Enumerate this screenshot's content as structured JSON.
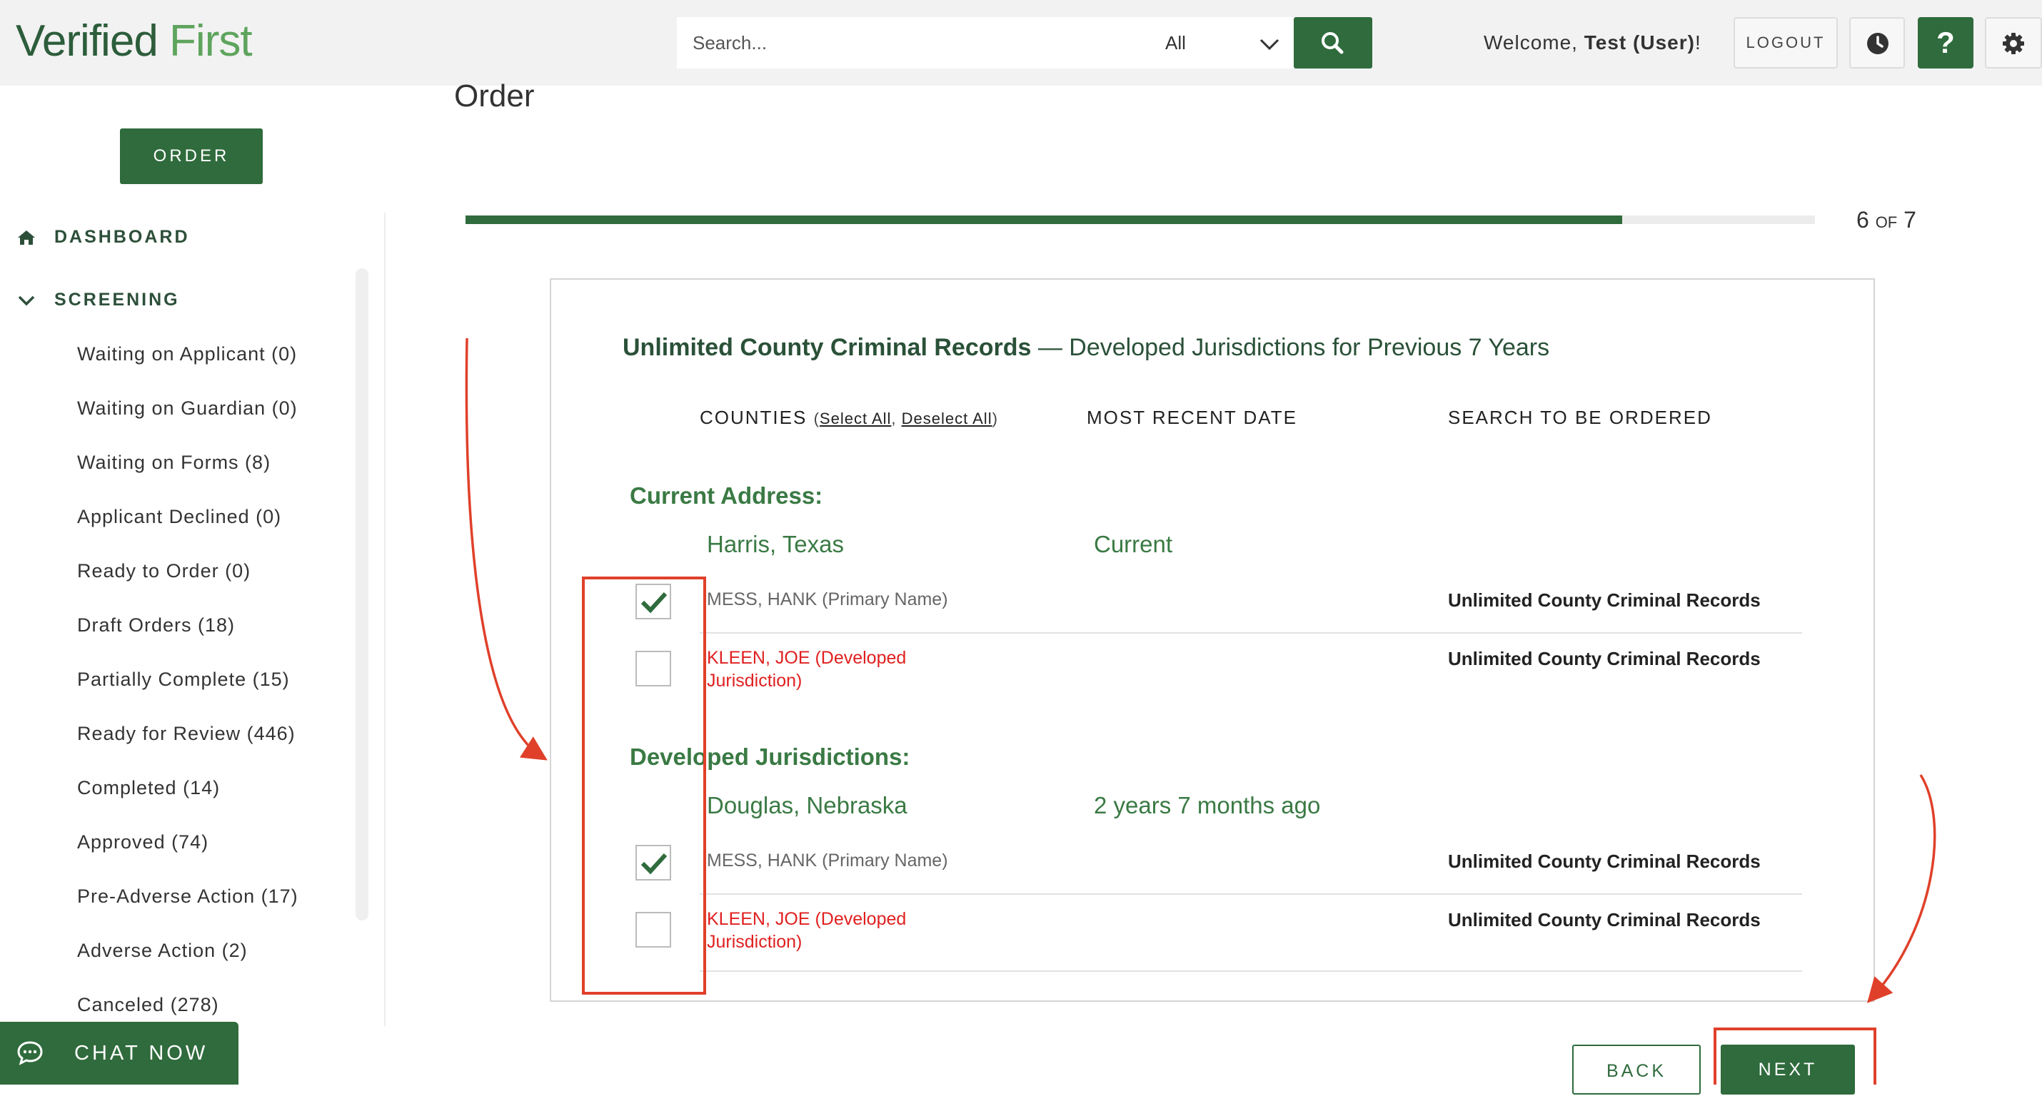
{
  "header": {
    "logo_part1": "Verified",
    "logo_part2": "First",
    "search_placeholder": "Search...",
    "search_scope": "All",
    "welcome_prefix": "Welcome, ",
    "welcome_user": "Test (User)",
    "welcome_suffix": "!",
    "logout_label": "LOGOUT",
    "help_label": "?"
  },
  "sidebar": {
    "order_label": "ORDER",
    "dashboard_label": "DASHBOARD",
    "screening_label": "SCREENING",
    "items": [
      "Waiting on Applicant (0)",
      "Waiting on Guardian (0)",
      "Waiting on Forms (8)",
      "Applicant Declined (0)",
      "Ready to Order (0)",
      "Draft Orders (18)",
      "Partially Complete (15)",
      "Ready for Review (446)",
      "Completed (14)",
      "Approved (74)",
      "Pre-Adverse Action (17)",
      "Adverse Action (2)",
      "Canceled (278)"
    ],
    "chat_label": "CHAT NOW"
  },
  "main": {
    "page_title": "Order",
    "progress": {
      "current": "6",
      "of": "OF",
      "total": "7",
      "fraction": 0.857
    },
    "section_title_bold": "Unlimited County Criminal Records",
    "section_title_rest": " — Developed Jurisdictions for Previous 7 Years",
    "columns": {
      "counties": "COUNTIES",
      "select_all": "Select All",
      "deselect_all": "Deselect All",
      "most_recent_date": "MOST RECENT DATE",
      "search_to_be_ordered": "SEARCH TO BE ORDERED"
    },
    "groups": [
      {
        "heading": "Current Address:",
        "county": "Harris, Texas",
        "date": "Current",
        "rows": [
          {
            "name": "MESS, HANK (Primary Name)",
            "search": "Unlimited County Criminal Records",
            "checked": true
          },
          {
            "name": "KLEEN, JOE (Developed Jurisdiction)",
            "search": "Unlimited County Criminal Records",
            "checked": false
          }
        ]
      },
      {
        "heading": "Developed Jurisdictions:",
        "county": "Douglas, Nebraska",
        "date": "2 years 7 months ago",
        "rows": [
          {
            "name": "MESS, HANK (Primary Name)",
            "search": "Unlimited County Criminal Records",
            "checked": true
          },
          {
            "name": "KLEEN, JOE (Developed Jurisdiction)",
            "search": "Unlimited County Criminal Records",
            "checked": false
          }
        ]
      }
    ],
    "back_label": "BACK",
    "next_label": "NEXT"
  },
  "colors": {
    "brand_green": "#2f6b3c",
    "section_green": "#3a7a44",
    "annotation_red": "#e0402a",
    "alt_name_red": "#e02020"
  }
}
